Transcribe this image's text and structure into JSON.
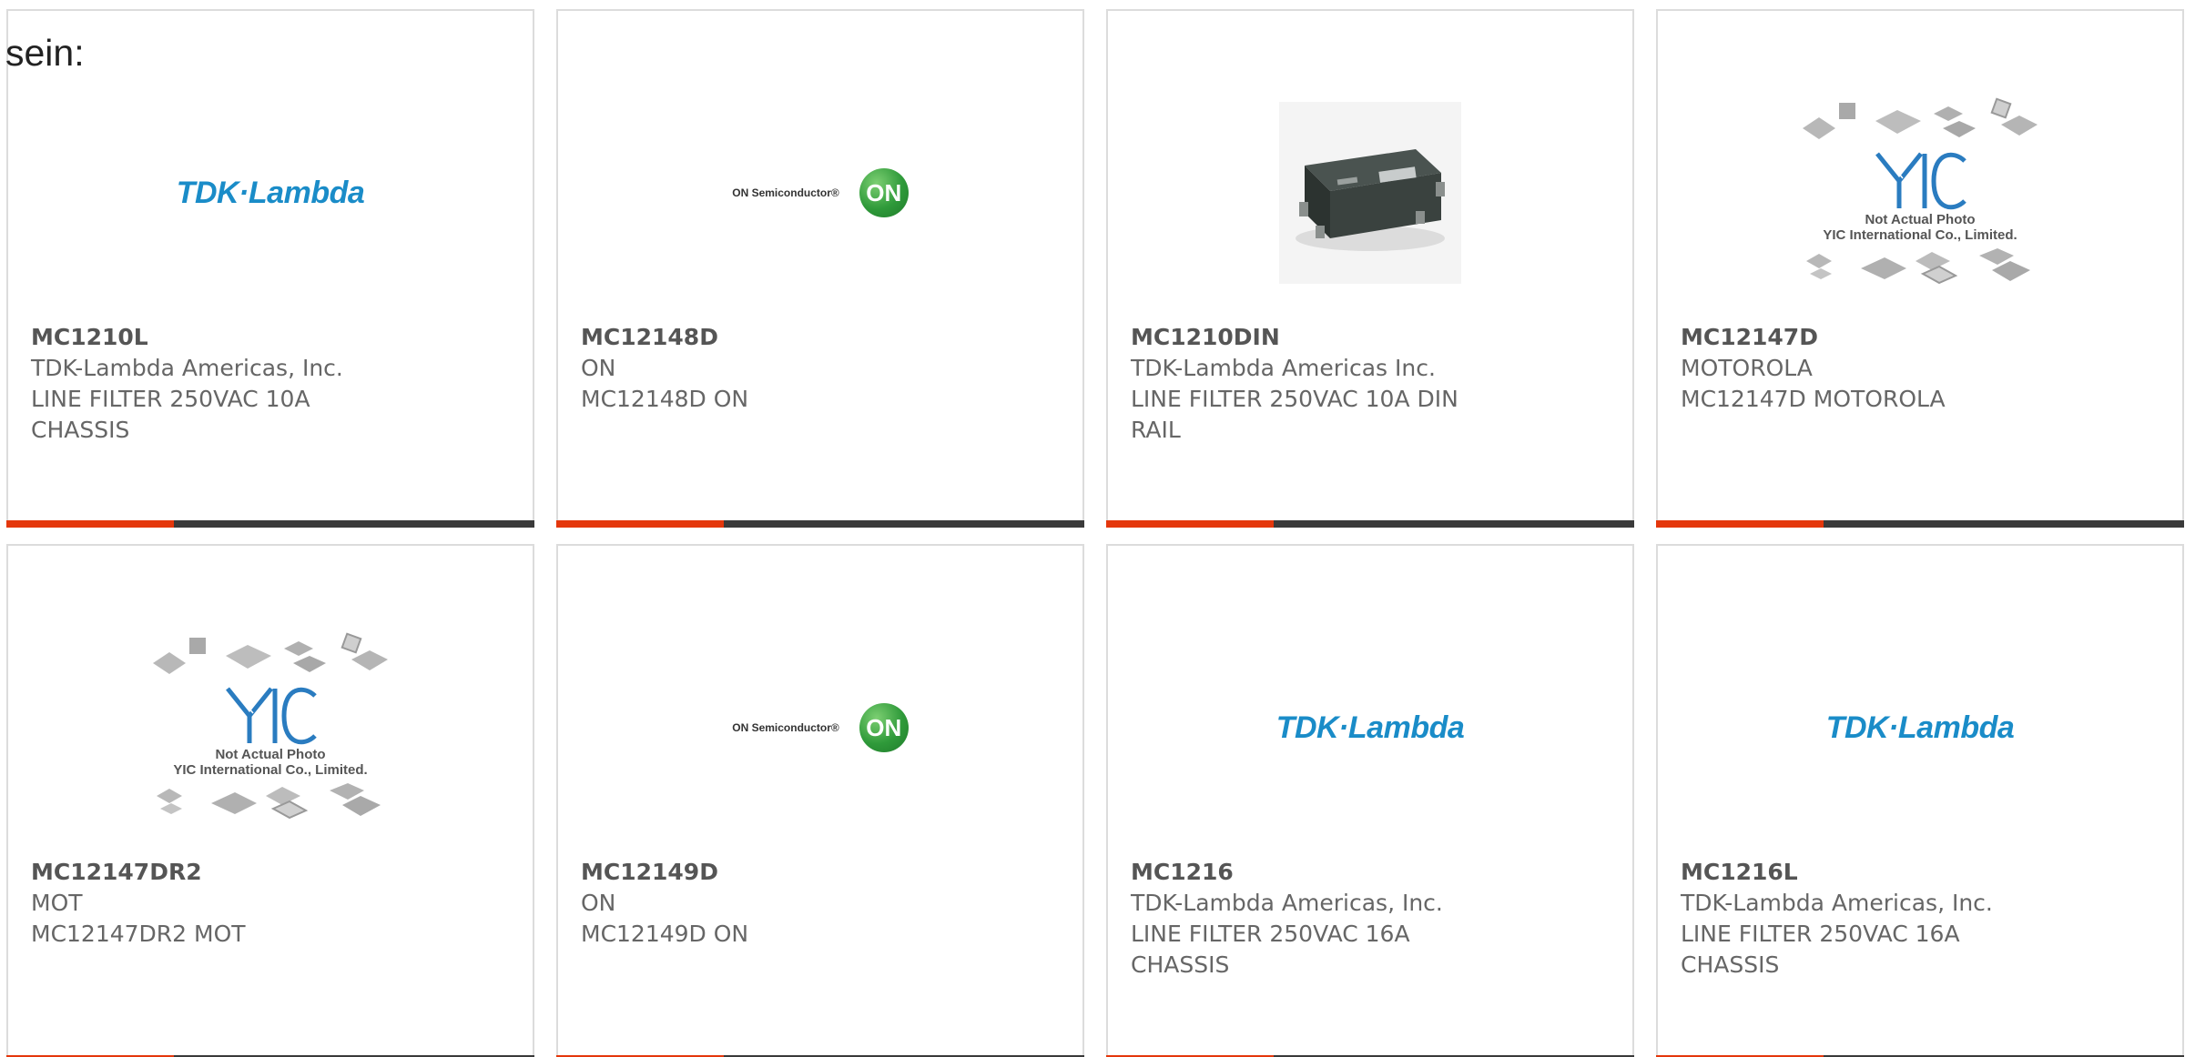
{
  "leading_text": "sein:",
  "colors": {
    "accent": "#e4370c",
    "bar": "#3a3a3a",
    "tdk_blue": "#1a8cc8",
    "on_green": "#2f9a3a"
  },
  "products": [
    {
      "part_number": "MC1210L",
      "manufacturer": "TDK-Lambda Americas, Inc.",
      "description": "LINE FILTER 250VAC 10A CHASSIS",
      "image": "tdk-lambda-logo",
      "logo_text": "TDK·Lambda"
    },
    {
      "part_number": "MC12148D",
      "manufacturer": "ON",
      "description": "MC12148D ON",
      "image": "on-semiconductor-logo",
      "logo_text": "ON Semiconductor®",
      "logo_mark": "ON"
    },
    {
      "part_number": "MC1210DIN",
      "manufacturer": "TDK-Lambda Americas Inc.",
      "description": "LINE FILTER 250VAC 10A DIN RAIL",
      "image": "line-filter-photo",
      "logo_text": ""
    },
    {
      "part_number": "MC12147D",
      "manufacturer": "MOTOROLA",
      "description": "MC12147D MOTOROLA",
      "image": "yic-placeholder",
      "logo_text": "Not Actual Photo",
      "logo_text_2": "YIC International Co., Limited."
    },
    {
      "part_number": "MC12147DR2",
      "manufacturer": "MOT",
      "description": "MC12147DR2 MOT",
      "image": "yic-placeholder",
      "logo_text": "Not Actual Photo",
      "logo_text_2": "YIC International Co., Limited."
    },
    {
      "part_number": "MC12149D",
      "manufacturer": "ON",
      "description": "MC12149D ON",
      "image": "on-semiconductor-logo",
      "logo_text": "ON Semiconductor®",
      "logo_mark": "ON"
    },
    {
      "part_number": "MC1216",
      "manufacturer": "TDK-Lambda Americas, Inc.",
      "description": "LINE FILTER 250VAC 16A CHASSIS",
      "image": "tdk-lambda-logo",
      "logo_text": "TDK·Lambda"
    },
    {
      "part_number": "MC1216L",
      "manufacturer": "TDK-Lambda Americas, Inc.",
      "description": "LINE FILTER 250VAC 16A CHASSIS",
      "image": "tdk-lambda-logo",
      "logo_text": "TDK·Lambda"
    }
  ]
}
